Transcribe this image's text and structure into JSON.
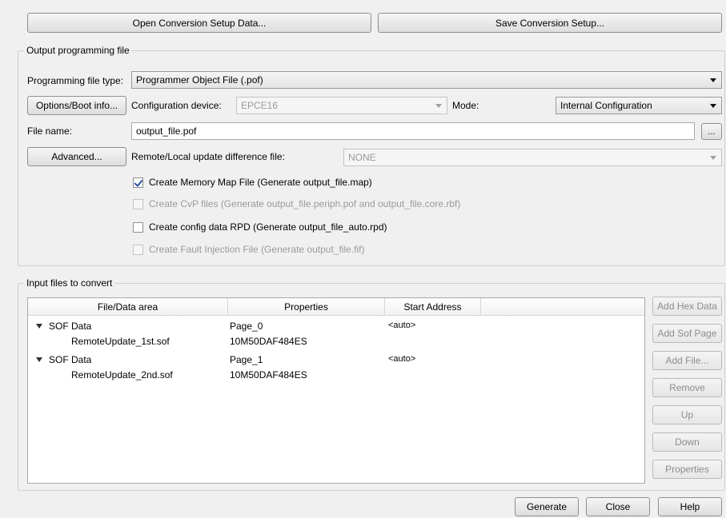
{
  "top_buttons": {
    "open_label": "Open Conversion Setup Data...",
    "save_label": "Save Conversion Setup..."
  },
  "output_group": {
    "title": "Output programming file",
    "programming_file_type_label": "Programming file type:",
    "programming_file_type_value": "Programmer Object File (.pof)",
    "options_button": "Options/Boot info...",
    "configuration_device_label": "Configuration device:",
    "configuration_device_value": "EPCE16",
    "mode_label": "Mode:",
    "mode_value": "Internal Configuration",
    "file_name_label": "File name:",
    "file_name_value": "output_file.pof",
    "browse_button": "...",
    "advanced_button": "Advanced...",
    "remote_local_label": "Remote/Local update difference file:",
    "remote_local_value": "NONE",
    "checkboxes": [
      {
        "label": "Create Memory Map File (Generate output_file.map)",
        "checked": true,
        "enabled": true
      },
      {
        "label": "Create CvP files (Generate output_file.periph.pof and output_file.core.rbf)",
        "checked": false,
        "enabled": false
      },
      {
        "label": "Create config data RPD (Generate output_file_auto.rpd)",
        "checked": false,
        "enabled": true
      },
      {
        "label": "Create Fault Injection File (Generate output_file.fif)",
        "checked": false,
        "enabled": false
      }
    ]
  },
  "input_group": {
    "title": "Input files to convert",
    "columns": [
      "File/Data area",
      "Properties",
      "Start Address",
      ""
    ],
    "rows": [
      {
        "name": "SOF Data",
        "properties": "Page_0",
        "start": "<auto>",
        "expanded": true
      },
      {
        "name": "RemoteUpdate_1st.sof",
        "properties": "10M50DAF484ES",
        "start": "",
        "child": true
      },
      {
        "name": "SOF Data",
        "properties": "Page_1",
        "start": "<auto>",
        "expanded": true
      },
      {
        "name": "RemoteUpdate_2nd.sof",
        "properties": "10M50DAF484ES",
        "start": "",
        "child": true
      }
    ],
    "side_buttons": [
      "Add Hex Data",
      "Add Sof Page",
      "Add File...",
      "Remove",
      "Up",
      "Down",
      "Properties"
    ]
  },
  "bottom_buttons": {
    "generate": "Generate",
    "close": "Close",
    "help": "Help"
  }
}
